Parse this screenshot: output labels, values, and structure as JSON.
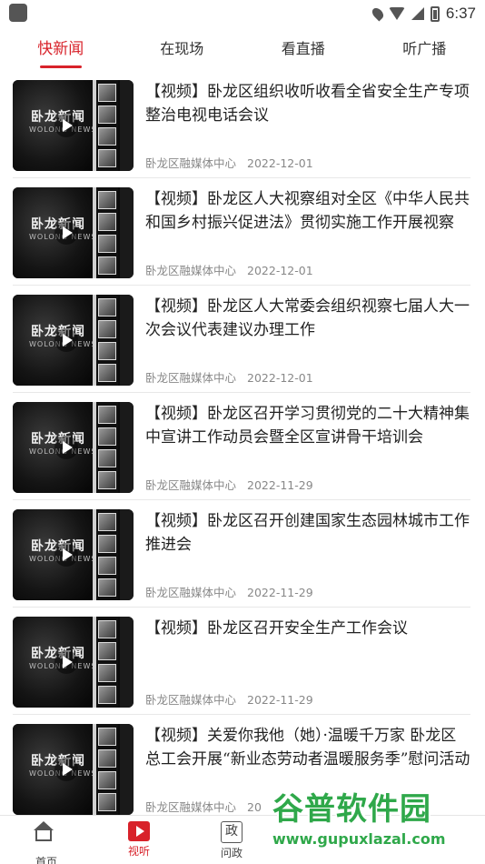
{
  "status_bar": {
    "time": "6:37",
    "icons": [
      "location-icon",
      "wifi-icon",
      "signal-icon",
      "battery-icon"
    ]
  },
  "tabs": [
    {
      "label": "快新闻",
      "active": true
    },
    {
      "label": "在现场",
      "active": false
    },
    {
      "label": "看直播",
      "active": false
    },
    {
      "label": "听广播",
      "active": false
    }
  ],
  "thumb": {
    "logo_text": "卧龙新闻",
    "logo_sub": "WOLONG NEWS"
  },
  "news": [
    {
      "title": "【视频】卧龙区组织收听收看全省安全生产专项整治电视电话会议",
      "source": "卧龙区融媒体中心",
      "date": "2022-12-01"
    },
    {
      "title": "【视频】卧龙区人大视察组对全区《中华人民共和国乡村振兴促进法》贯彻实施工作开展视察",
      "source": "卧龙区融媒体中心",
      "date": "2022-12-01"
    },
    {
      "title": "【视频】卧龙区人大常委会组织视察七届人大一次会议代表建议办理工作",
      "source": "卧龙区融媒体中心",
      "date": "2022-12-01"
    },
    {
      "title": "【视频】卧龙区召开学习贯彻党的二十大精神集中宣讲工作动员会暨全区宣讲骨干培训会",
      "source": "卧龙区融媒体中心",
      "date": "2022-11-29"
    },
    {
      "title": "【视频】卧龙区召开创建国家生态园林城市工作推进会",
      "source": "卧龙区融媒体中心",
      "date": "2022-11-29"
    },
    {
      "title": "【视频】卧龙区召开安全生产工作会议",
      "source": "卧龙区融媒体中心",
      "date": "2022-11-29"
    },
    {
      "title": "【视频】关爱你我他（她）·温暖千万家 卧龙区总工会开展“新业态劳动者温暖服务季”慰问活动",
      "source": "卧龙区融媒体中心",
      "date": "20"
    }
  ],
  "bottom_nav": [
    {
      "label": "首页",
      "icon": "home-icon",
      "active": false
    },
    {
      "label": "视听",
      "icon": "video-icon",
      "active": true
    },
    {
      "label": "问政",
      "icon": "zheng-icon",
      "icon_text": "政",
      "active": false
    }
  ],
  "watermark": {
    "line1": "谷普软件园",
    "line2": "www.gupuxlazal.com"
  },
  "colors": {
    "accent": "#d8222a",
    "watermark": "#2fa84a"
  }
}
